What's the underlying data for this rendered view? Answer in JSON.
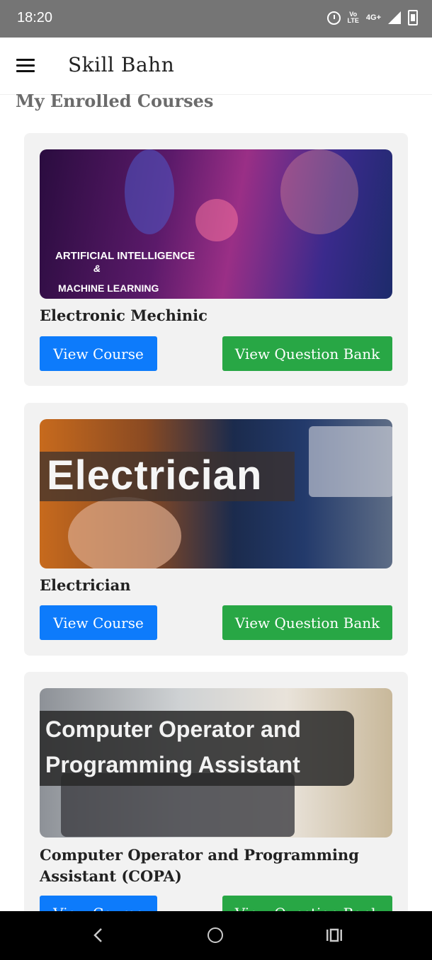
{
  "status_bar": {
    "time": "18:20",
    "volte_label": "Vo\nLTE",
    "network": "4G+",
    "icons": [
      "alarm-icon",
      "volte-icon",
      "signal-icon",
      "battery-icon"
    ]
  },
  "app_bar": {
    "title": "Skill Bahn",
    "menu_icon": "hamburger-icon"
  },
  "page": {
    "section_title": "My Enrolled Courses"
  },
  "courses": [
    {
      "name": "Electronic Mechinic",
      "thumbnail_text": [
        "ARTIFICIAL INTELLIGENCE",
        "&",
        "MACHINE LEARNING"
      ],
      "view_course_label": "View Course",
      "view_qbank_label": "View Question Bank"
    },
    {
      "name": "Electrician",
      "thumbnail_text": [
        "Electrician"
      ],
      "view_course_label": "View Course",
      "view_qbank_label": "View Question Bank"
    },
    {
      "name": "Computer Operator and Programming Assistant (COPA)",
      "thumbnail_text": [
        "Computer Operator and",
        "Programming Assistant"
      ],
      "view_course_label": "View Course",
      "view_qbank_label": "View Question Bank"
    }
  ],
  "nav_bar": {
    "icons": [
      "back-icon",
      "home-icon",
      "recents-icon"
    ]
  },
  "colors": {
    "status_bar": "#757575",
    "card_bg": "#f2f2f2",
    "primary_button": "#0d7bfb",
    "success_button": "#28a745",
    "section_title": "#6b6b6b"
  }
}
